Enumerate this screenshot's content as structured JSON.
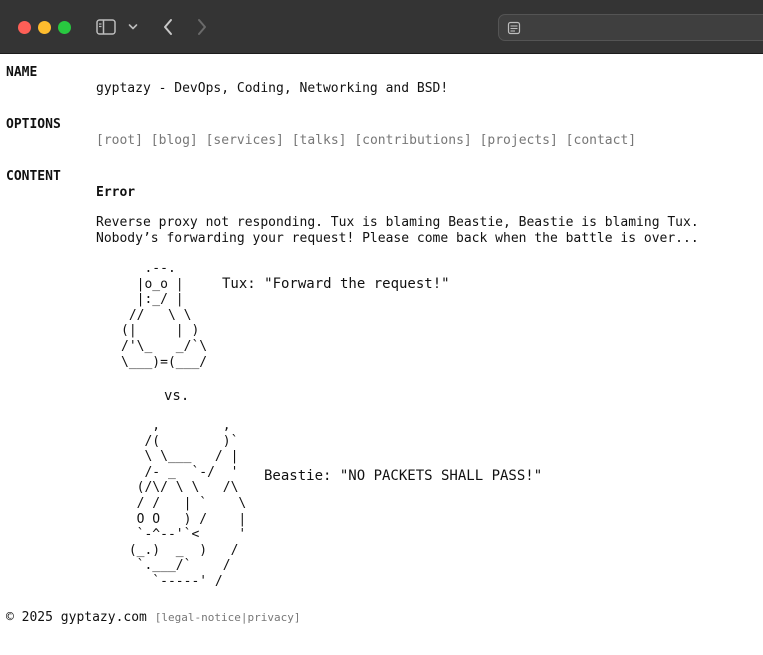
{
  "chrome": {
    "sidebar_icon": "sidebar-icon",
    "chevron_icon": "chevron-down-icon",
    "back_icon": "back-arrow-icon",
    "forward_icon": "forward-arrow-icon",
    "address_icon": "page-menu-icon"
  },
  "sections": {
    "name_title": "NAME",
    "options_title": "OPTIONS",
    "content_title": "CONTENT"
  },
  "name": {
    "text": "gyptazy - DevOps, Coding, Networking and BSD!"
  },
  "options": {
    "links": [
      "[root]",
      "[blog]",
      "[services]",
      "[talks]",
      "[contributions]",
      "[projects]",
      "[contact]"
    ]
  },
  "content": {
    "error_title": "Error",
    "message_line1": "Reverse proxy not responding. Tux is blaming Beastie, Beastie is blaming Tux.",
    "message_line2": "Nobody’s forwarding your request! Please come back when the battle is over...",
    "tux_ascii": "   .--.\n  |o_o |\n  |:_/ |\n //   \\ \\\n(|     | )\n/'\\_   _/`\\\n\\___)=(___/",
    "tux_quote": "Tux: \"Forward the request!\"",
    "versus": "vs.",
    "beastie_ascii": "    ,        ,\n   /(        )`\n   \\ \\___   / |\n   /- _  `-/  '\n  (/\\/ \\ \\   /\\\n  / /   | `    \\\n  O O   ) /    |\n  `-^--'`<     '\n (_.)  _  )   /\n  `.___/`    /\n    `-----' /",
    "beastie_quote": "Beastie: \"NO PACKETS SHALL PASS!\""
  },
  "footer": {
    "copyright": "© 2025 gyptazy.com ",
    "open_bracket": "[",
    "legal_notice": "legal-notice",
    "divider": "|",
    "privacy": "privacy",
    "close_bracket": "]"
  }
}
